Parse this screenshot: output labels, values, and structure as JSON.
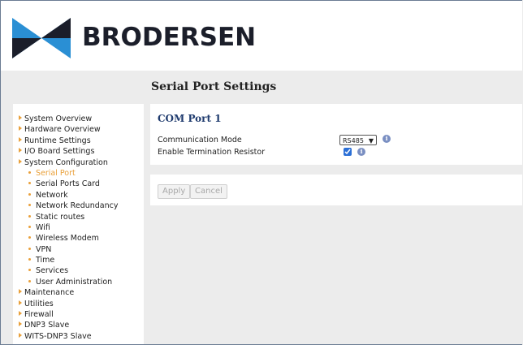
{
  "header": {
    "logo_text": "BRODERSEN"
  },
  "page": {
    "title": "Serial Port Settings"
  },
  "sidebar": {
    "items": [
      {
        "label": "System Overview",
        "level": "top",
        "active": false
      },
      {
        "label": "Hardware Overview",
        "level": "top",
        "active": false
      },
      {
        "label": "Runtime Settings",
        "level": "top",
        "active": false
      },
      {
        "label": "I/O Board Settings",
        "level": "top",
        "active": false
      },
      {
        "label": "System Configuration",
        "level": "top",
        "active": false
      },
      {
        "label": "Serial Port",
        "level": "sub",
        "active": true
      },
      {
        "label": "Serial Ports Card",
        "level": "sub",
        "active": false
      },
      {
        "label": "Network",
        "level": "sub",
        "active": false
      },
      {
        "label": "Network Redundancy",
        "level": "sub",
        "active": false
      },
      {
        "label": "Static routes",
        "level": "sub",
        "active": false
      },
      {
        "label": "Wifi",
        "level": "sub",
        "active": false
      },
      {
        "label": "Wireless Modem",
        "level": "sub",
        "active": false
      },
      {
        "label": "VPN",
        "level": "sub",
        "active": false
      },
      {
        "label": "Time",
        "level": "sub",
        "active": false
      },
      {
        "label": "Services",
        "level": "sub",
        "active": false
      },
      {
        "label": "User Administration",
        "level": "sub",
        "active": false
      },
      {
        "label": "Maintenance",
        "level": "top",
        "active": false
      },
      {
        "label": "Utilities",
        "level": "top",
        "active": false
      },
      {
        "label": "Firewall",
        "level": "top",
        "active": false
      },
      {
        "label": "DNP3 Slave",
        "level": "top",
        "active": false
      },
      {
        "label": "WITS-DNP3 Slave",
        "level": "top",
        "active": false
      }
    ]
  },
  "com_port": {
    "title": "COM Port 1",
    "mode_label": "Communication Mode",
    "mode_value": "RS485",
    "termination_label": "Enable Termination Resistor",
    "termination_checked": true,
    "info_glyph": "i"
  },
  "actions": {
    "apply_label": "Apply",
    "cancel_label": "Cancel"
  },
  "colors": {
    "accent": "#e9a03a",
    "title_blue": "#1f3b6e",
    "logo_blue": "#2a8fd4",
    "logo_dark": "#1b1e2a",
    "checkbox": "#2b6fd6"
  }
}
